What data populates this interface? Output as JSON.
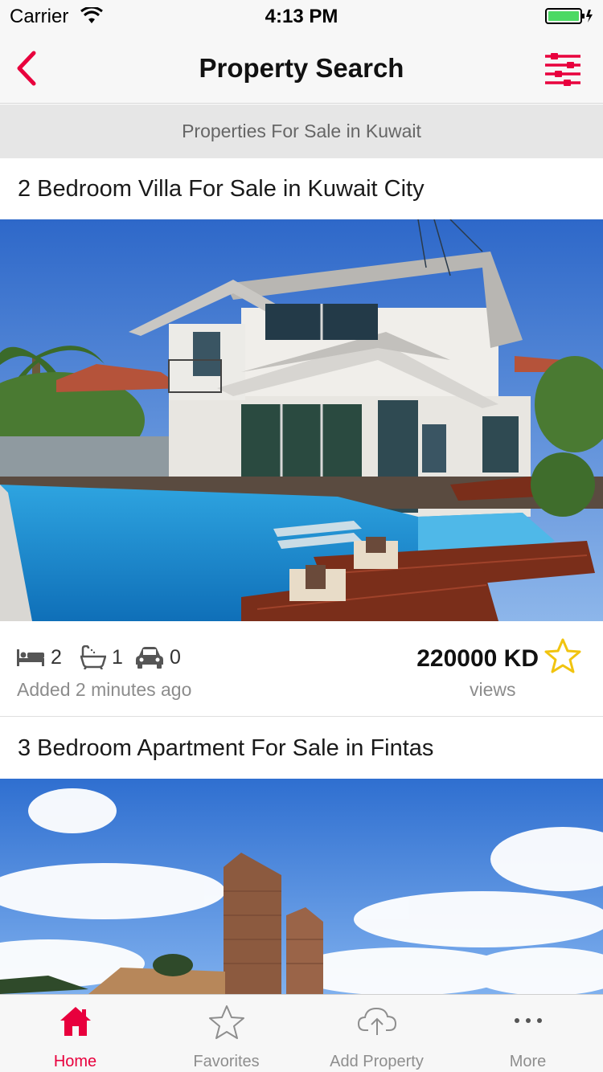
{
  "status_bar": {
    "carrier": "Carrier",
    "time": "4:13 PM"
  },
  "nav": {
    "title": "Property Search",
    "back_icon": "chevron-left-icon",
    "filter_icon": "sliders-icon",
    "accent_color": "#e8003d"
  },
  "section_header": "Properties For Sale in Kuwait",
  "listings": [
    {
      "title": "2 Bedroom Villa For Sale in Kuwait City",
      "bedrooms": "2",
      "bathrooms": "1",
      "parking": "0",
      "added": "Added 2 minutes ago",
      "price": "220000 KD",
      "views": "views"
    },
    {
      "title": "3 Bedroom Apartment For Sale in Fintas"
    }
  ],
  "tabs": [
    {
      "label": "Home",
      "icon": "home-icon",
      "active": true
    },
    {
      "label": "Favorites",
      "icon": "star-icon",
      "active": false
    },
    {
      "label": "Add Property",
      "icon": "cloud-upload-icon",
      "active": false
    },
    {
      "label": "More",
      "icon": "more-dots-icon",
      "active": false
    }
  ]
}
